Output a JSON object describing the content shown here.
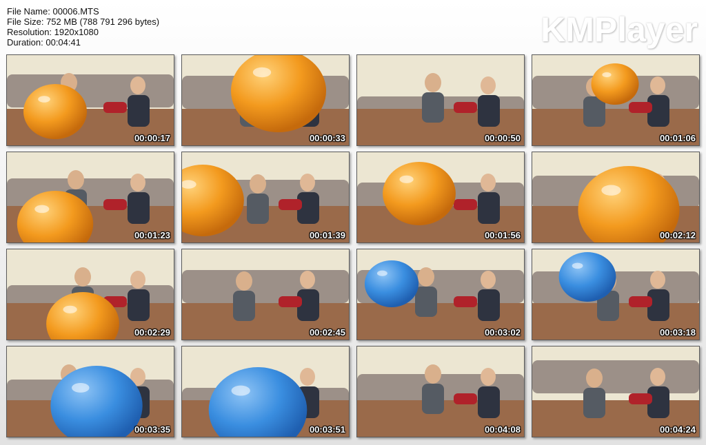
{
  "file_info": {
    "name_line": "File Name: 00006.MTS",
    "size_line": "File Size: 752 MB (788 791 296 bytes)",
    "resolution_line": "Resolution: 1920x1080",
    "duration_line": "Duration: 00:04:41"
  },
  "logo": "KMPlayer",
  "colors": {
    "orange_balloon": "#f39a1e",
    "blue_balloon": "#3a8ee0",
    "wall": "#ece6d2",
    "sofa": "#9c9088",
    "carpet": "#9a6a4a"
  },
  "thumbnails": [
    {
      "time": "00:00:17",
      "balloon": "orange"
    },
    {
      "time": "00:00:33",
      "balloon": "orange"
    },
    {
      "time": "00:00:50",
      "balloon": "none"
    },
    {
      "time": "00:01:06",
      "balloon": "orange"
    },
    {
      "time": "00:01:23",
      "balloon": "orange"
    },
    {
      "time": "00:01:39",
      "balloon": "orange"
    },
    {
      "time": "00:01:56",
      "balloon": "orange"
    },
    {
      "time": "00:02:12",
      "balloon": "orange"
    },
    {
      "time": "00:02:29",
      "balloon": "orange"
    },
    {
      "time": "00:02:45",
      "balloon": "none"
    },
    {
      "time": "00:03:02",
      "balloon": "blue"
    },
    {
      "time": "00:03:18",
      "balloon": "blue"
    },
    {
      "time": "00:03:35",
      "balloon": "blue"
    },
    {
      "time": "00:03:51",
      "balloon": "blue"
    },
    {
      "time": "00:04:08",
      "balloon": "none"
    },
    {
      "time": "00:04:24",
      "balloon": "none"
    }
  ]
}
